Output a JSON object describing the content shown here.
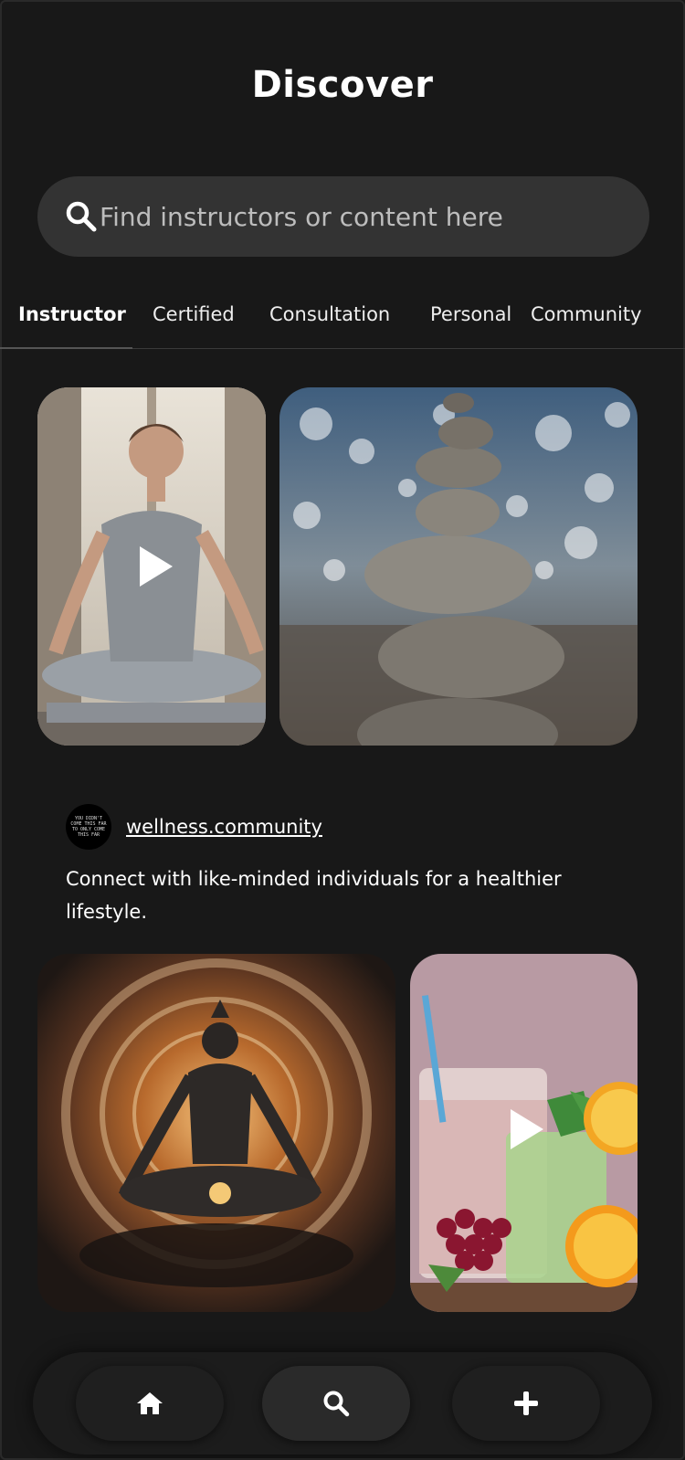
{
  "header": {
    "title": "Discover"
  },
  "search": {
    "placeholder": "Find instructors or content here",
    "icon": "search-icon"
  },
  "tabs": [
    {
      "label": "Instructor",
      "active": true
    },
    {
      "label": "Certified",
      "active": false
    },
    {
      "label": "Consultation",
      "active": false
    },
    {
      "label": "Personal",
      "active": false
    },
    {
      "label": "Community",
      "active": false
    }
  ],
  "posts": {
    "first_row": [
      {
        "subject": "woman meditating in lotus pose",
        "is_video": true
      },
      {
        "subject": "stacked balance stones",
        "is_video": false
      }
    ],
    "author": {
      "handle": "wellness.community",
      "avatar_text": "YOU DIDN'T COME THIS FAR TO ONLY COME THIS FAR"
    },
    "description": "Connect with like-minded individuals for a healthier lifestyle.",
    "second_row": [
      {
        "subject": "glowing meditating figure with mandala",
        "is_video": false
      },
      {
        "subject": "fresh drinks with fruit",
        "is_video": true
      }
    ]
  },
  "bottom_nav": [
    {
      "icon": "home-icon",
      "active": false
    },
    {
      "icon": "search-icon",
      "active": true
    },
    {
      "icon": "plus-icon",
      "active": false
    }
  ],
  "colors": {
    "background": "#181818",
    "search_bg": "#333333",
    "text": "#ffffff"
  }
}
